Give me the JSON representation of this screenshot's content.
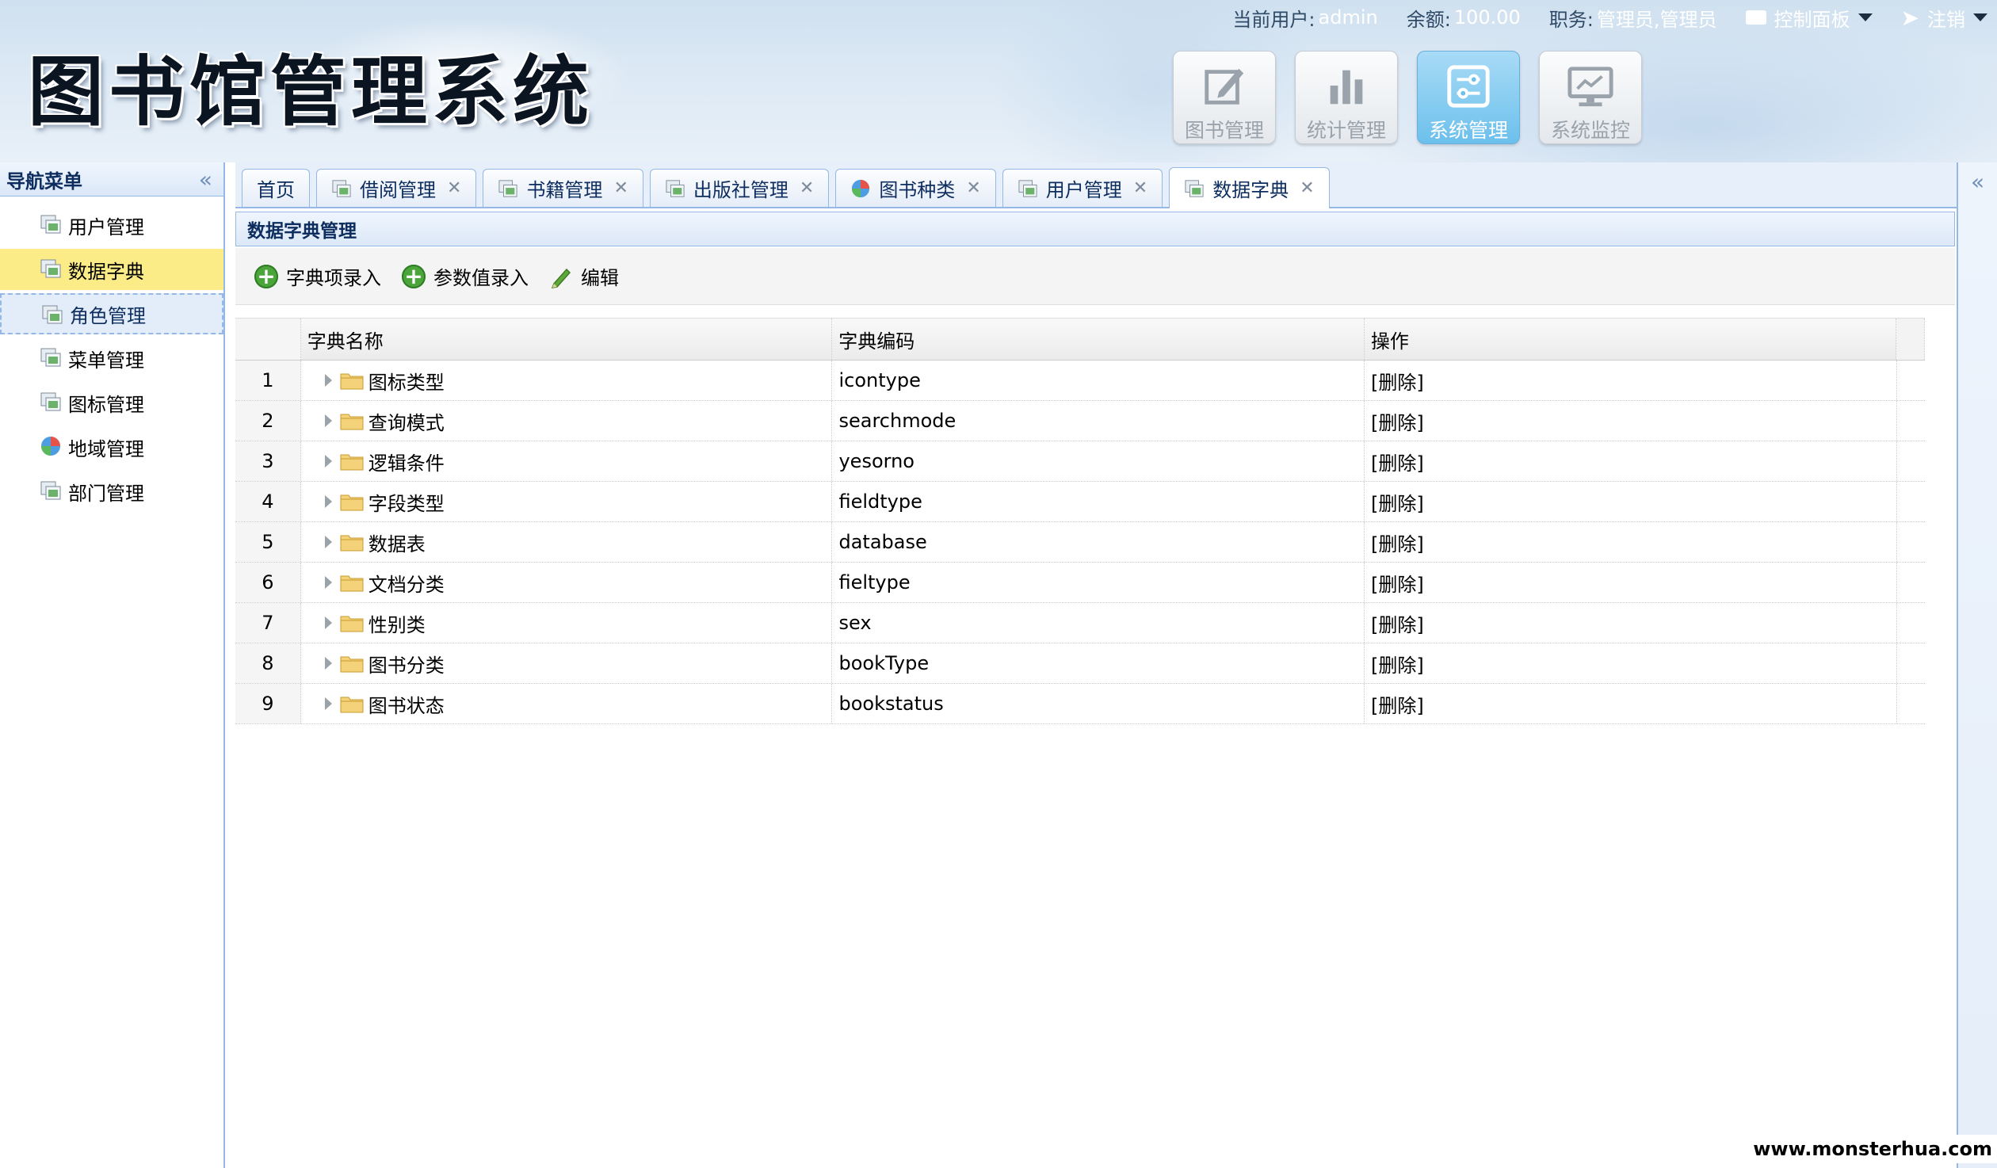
{
  "app": {
    "title": "图书馆管理系统"
  },
  "userbar": {
    "current_user_label": "当前用户:",
    "current_user": "admin",
    "balance_label": "余额:",
    "balance": "100.00",
    "role_label": "职务:",
    "role": "管理员,管理员",
    "control_panel": "控制面板",
    "logout": "注销"
  },
  "modules": [
    {
      "label": "图书管理",
      "icon": "edit-icon",
      "active": false
    },
    {
      "label": "统计管理",
      "icon": "bar-chart-icon",
      "active": false
    },
    {
      "label": "系统管理",
      "icon": "settings-sliders-icon",
      "active": true
    },
    {
      "label": "系统监控",
      "icon": "monitor-icon",
      "active": false
    }
  ],
  "nav": {
    "title": "导航菜单",
    "items": [
      {
        "label": "用户管理",
        "icon": "window-icon",
        "state": "normal"
      },
      {
        "label": "数据字典",
        "icon": "window-icon",
        "state": "selected"
      },
      {
        "label": "角色管理",
        "icon": "window-icon",
        "state": "hover"
      },
      {
        "label": "菜单管理",
        "icon": "window-icon",
        "state": "normal"
      },
      {
        "label": "图标管理",
        "icon": "window-icon",
        "state": "normal"
      },
      {
        "label": "地域管理",
        "icon": "globe-icon",
        "state": "normal"
      },
      {
        "label": "部门管理",
        "icon": "window-icon",
        "state": "normal"
      }
    ]
  },
  "tabs": [
    {
      "label": "首页",
      "closable": false,
      "icon": ""
    },
    {
      "label": "借阅管理",
      "closable": true,
      "icon": "window-icon"
    },
    {
      "label": "书籍管理",
      "closable": true,
      "icon": "window-icon"
    },
    {
      "label": "出版社管理",
      "closable": true,
      "icon": "window-icon"
    },
    {
      "label": "图书种类",
      "closable": true,
      "icon": "globe-icon"
    },
    {
      "label": "用户管理",
      "closable": true,
      "icon": "window-icon"
    },
    {
      "label": "数据字典",
      "closable": true,
      "icon": "window-icon",
      "active": true
    }
  ],
  "panel": {
    "title": "数据字典管理"
  },
  "toolbar": {
    "add_dict_item": "字典项录入",
    "add_param_value": "参数值录入",
    "edit": "编辑"
  },
  "grid": {
    "columns": [
      "字典名称",
      "字典编码",
      "操作"
    ],
    "rows": [
      {
        "idx": "1",
        "name": "图标类型",
        "code": "icontype",
        "op": "[删除]"
      },
      {
        "idx": "2",
        "name": "查询模式",
        "code": "searchmode",
        "op": "[删除]"
      },
      {
        "idx": "3",
        "name": "逻辑条件",
        "code": "yesorno",
        "op": "[删除]"
      },
      {
        "idx": "4",
        "name": "字段类型",
        "code": "fieldtype",
        "op": "[删除]"
      },
      {
        "idx": "5",
        "name": "数据表",
        "code": "database",
        "op": "[删除]"
      },
      {
        "idx": "6",
        "name": "文档分类",
        "code": "fieltype",
        "op": "[删除]"
      },
      {
        "idx": "7",
        "name": "性别类",
        "code": "sex",
        "op": "[删除]"
      },
      {
        "idx": "8",
        "name": "图书分类",
        "code": "bookType",
        "op": "[删除]"
      },
      {
        "idx": "9",
        "name": "图书状态",
        "code": "bookstatus",
        "op": "[删除]"
      }
    ]
  },
  "watermark": "www.monsterhua.com",
  "colors": {
    "accent_border": "#95b8e7",
    "selected_row": "#fbec88",
    "active_module": "#6cc0ec",
    "add_button_green": "#4ca53b"
  }
}
